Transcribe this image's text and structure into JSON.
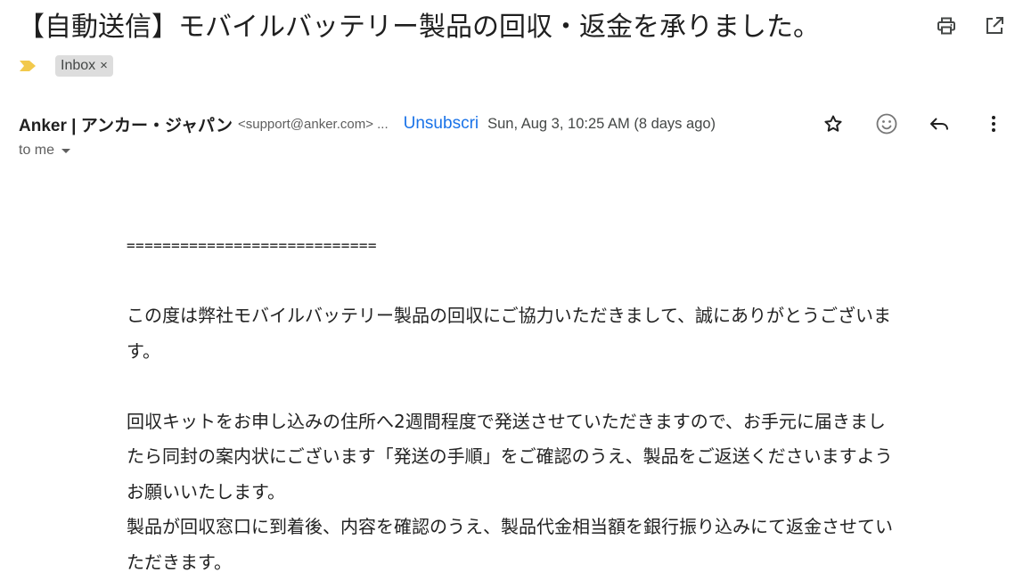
{
  "email": {
    "subject": "【自動送信】モバイルバッテリー製品の回収・返金を承りました。",
    "label": "Inbox",
    "label_remove": "×",
    "sender_name": "Anker | アンカー・ジャパン",
    "sender_email": "<support@anker.com> ...",
    "unsubscribe": "Unsubscri",
    "date": "Sun, Aug 3, 10:25 AM (8 days ago)",
    "recipient": "to me"
  },
  "body": {
    "separator": "============================",
    "paragraph1": "この度は弊社モバイルバッテリー製品の回収にご協力いただきまして、誠にありがとうございます。",
    "paragraph2": "回収キットをお申し込みの住所へ2週間程度で発送させていただきますので、お手元に届きましたら同封の案内状にございます「発送の手順」をご確認のうえ、製品をご返送くださいますようお願いいたします。",
    "paragraph3": "製品が回収窓口に到着後、内容を確認のうえ、製品代金相当額を銀行振り込みにて返金させていただきます。"
  },
  "icons": {
    "print": "print-icon",
    "popout": "open-in-new-window-icon",
    "importance": "importance-marker-icon",
    "star": "star-icon",
    "emoji": "emoji-reaction-icon",
    "reply": "reply-icon",
    "more": "more-vertical-icon",
    "recipient_details": "chevron-down-icon"
  },
  "colors": {
    "importance": "#f2c94c",
    "link": "#1a73e8",
    "label_chip": "#dddddd",
    "text": "#1f1f1f"
  }
}
